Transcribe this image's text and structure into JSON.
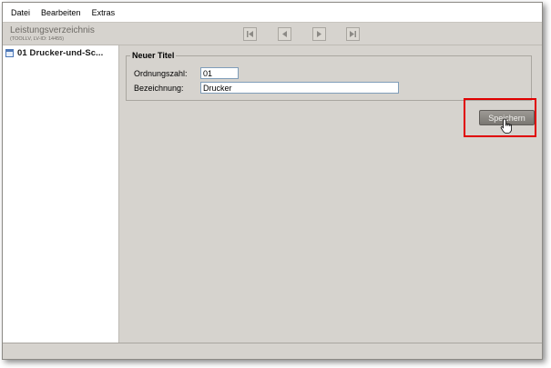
{
  "menu": {
    "items": [
      {
        "label": "Datei"
      },
      {
        "label": "Bearbeiten"
      },
      {
        "label": "Extras"
      }
    ]
  },
  "header": {
    "title": "Leistungsverzeichnis",
    "subtitle": "(TOOLLV, LV-ID: 14455)"
  },
  "nav": {
    "icons": [
      "first-page-icon",
      "previous-page-icon",
      "next-page-icon",
      "last-page-icon"
    ]
  },
  "tree": {
    "items": [
      {
        "label": "01 Drucker-und-Sc...",
        "icon": "table-icon"
      }
    ]
  },
  "form": {
    "legend": "Neuer Titel",
    "ordnungszahl_label": "Ordnungszahl:",
    "ordnungszahl_value": "01",
    "bezeichnung_label": "Bezeichnung:",
    "bezeichnung_value": "Drucker"
  },
  "actions": {
    "save_label": "Speichern"
  },
  "colors": {
    "highlight": "#e00000",
    "window_bg": "#d6d3ce"
  }
}
